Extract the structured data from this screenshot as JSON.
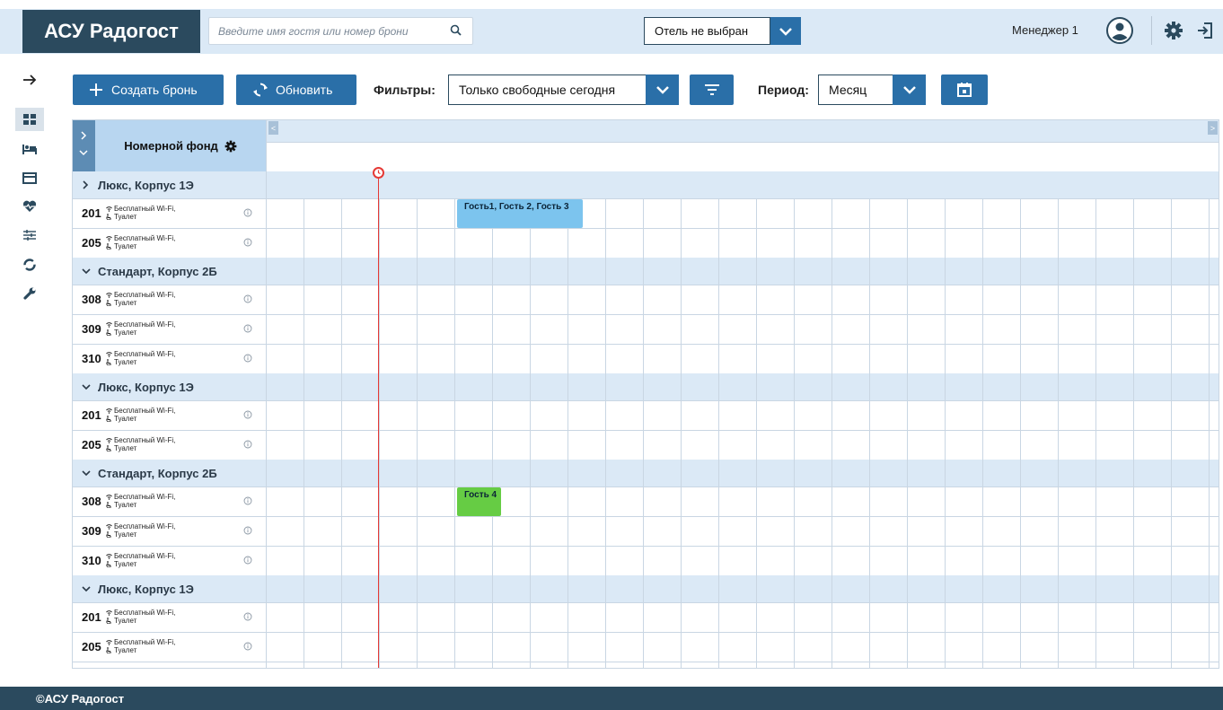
{
  "app": {
    "title": "АСУ Радогост"
  },
  "search": {
    "placeholder": "Введите имя гостя или номер брони",
    "value": ""
  },
  "hotel_select": {
    "value": "Отель не выбран"
  },
  "user": {
    "name": "Менеджер 1"
  },
  "toolbar": {
    "create_label": "Создать бронь",
    "refresh_label": "Обновить",
    "filters_label": "Фильтры:",
    "filter_value": "Только свободные сегодня",
    "period_label": "Период:",
    "period_value": "Месяц"
  },
  "grid": {
    "room_fund_label": "Номерной фонд",
    "groups": [
      {
        "name": "Люкс, Корпус 1Э",
        "expanded": false,
        "rooms": [
          {
            "number": "201",
            "amenity1": "Бесплатный Wi-Fi,",
            "amenity2": "Туалет"
          },
          {
            "number": "205",
            "amenity1": "Бесплатный Wi-Fi,",
            "amenity2": "Туалет"
          }
        ]
      },
      {
        "name": "Стандарт, Корпус 2Б",
        "expanded": true,
        "rooms": [
          {
            "number": "308",
            "amenity1": "Бесплатный Wi-Fi,",
            "amenity2": "Туалет"
          },
          {
            "number": "309",
            "amenity1": "Бесплатный Wi-Fi,",
            "amenity2": "Туалет"
          },
          {
            "number": "310",
            "amenity1": "Бесплатный Wi-Fi,",
            "amenity2": "Туалет"
          }
        ]
      },
      {
        "name": "Люкс, Корпус 1Э",
        "expanded": true,
        "rooms": [
          {
            "number": "201",
            "amenity1": "Бесплатный Wi-Fi,",
            "amenity2": "Туалет"
          },
          {
            "number": "205",
            "amenity1": "Бесплатный Wi-Fi,",
            "amenity2": "Туалет"
          }
        ]
      },
      {
        "name": "Стандарт, Корпус 2Б",
        "expanded": true,
        "rooms": [
          {
            "number": "308",
            "amenity1": "Бесплатный Wi-Fi,",
            "amenity2": "Туалет"
          },
          {
            "number": "309",
            "amenity1": "Бесплатный Wi-Fi,",
            "amenity2": "Туалет"
          },
          {
            "number": "310",
            "amenity1": "Бесплатный Wi-Fi,",
            "amenity2": "Туалет"
          }
        ]
      },
      {
        "name": "Люкс, Корпус 1Э",
        "expanded": true,
        "rooms": [
          {
            "number": "201",
            "amenity1": "Бесплатный Wi-Fi,",
            "amenity2": "Туалет"
          },
          {
            "number": "205",
            "amenity1": "Бесплатный Wi-Fi,",
            "amenity2": "Туалет"
          }
        ]
      }
    ],
    "bookings": [
      {
        "label": "Гость1, Гость 2, Гость 3",
        "color": "#7cc4ee"
      },
      {
        "label": "Гость 4",
        "color": "#66cc44"
      }
    ]
  },
  "footer": {
    "text": "©АСУ Радогост"
  },
  "colors": {
    "dark": "#2b4a5e",
    "accent": "#2a6fa8",
    "light": "#dbe9f6",
    "now_line": "#e53935"
  }
}
